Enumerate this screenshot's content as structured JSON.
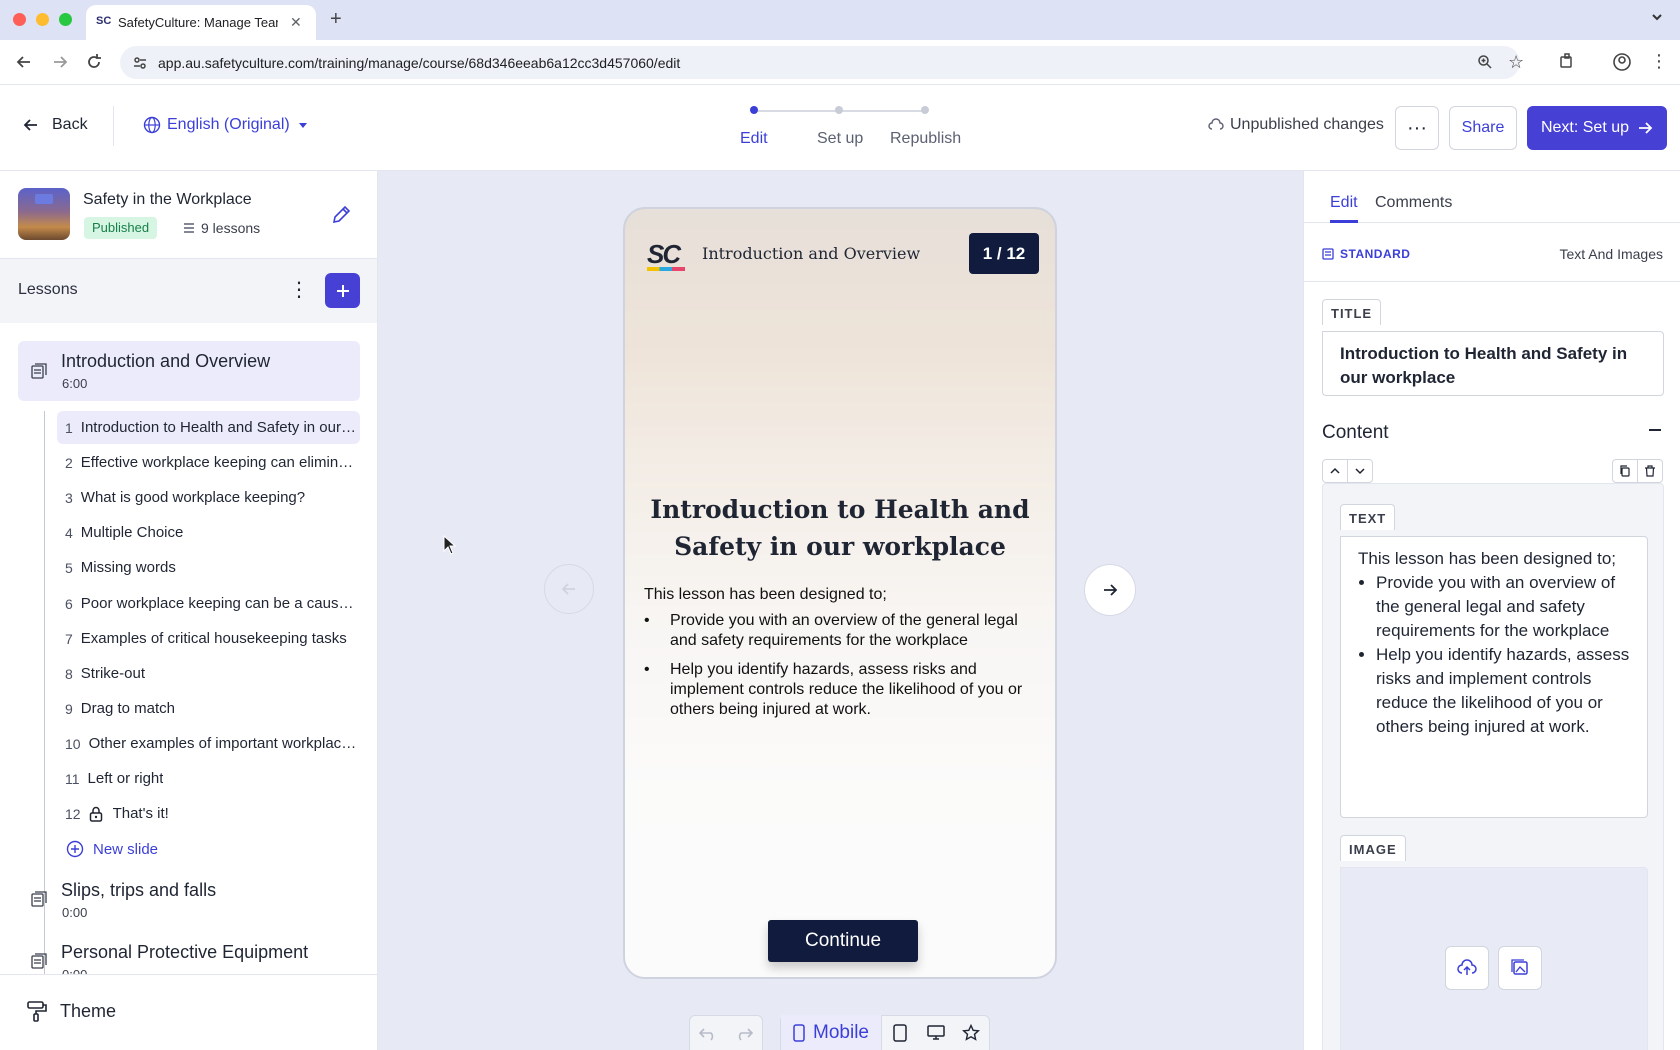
{
  "browser": {
    "tab_title": "SafetyCulture: Manage Teams",
    "url": "app.au.safetyculture.com/training/manage/course/68d346eeab6a12cc3d457060/edit"
  },
  "header": {
    "back_label": "Back",
    "language_label": "English (Original)",
    "steps": [
      "Edit",
      "Set up",
      "Republish"
    ],
    "active_step": 0,
    "unpublished_label": "Unpublished changes",
    "share_label": "Share",
    "next_label": "Next: Set up"
  },
  "course": {
    "title": "Safety in the Workplace",
    "status": "Published",
    "lessons_count": "9 lessons"
  },
  "sidebar": {
    "lessons_label": "Lessons",
    "lessons": [
      {
        "title": "Introduction and Overview",
        "duration": "6:00"
      },
      {
        "title": "Slips, trips and falls",
        "duration": "0:00"
      },
      {
        "title": "Personal Protective Equipment",
        "duration": "0:00"
      }
    ],
    "slides": [
      {
        "num": "1",
        "title": "Introduction to Health and Safety in our workplace"
      },
      {
        "num": "2",
        "title": "Effective workplace keeping can eliminate hazards"
      },
      {
        "num": "3",
        "title": "What is good workplace keeping?"
      },
      {
        "num": "4",
        "title": "Multiple Choice"
      },
      {
        "num": "5",
        "title": "Missing words"
      },
      {
        "num": "6",
        "title": "Poor workplace keeping can be a cause of accidents"
      },
      {
        "num": "7",
        "title": "Examples of critical housekeeping tasks"
      },
      {
        "num": "8",
        "title": "Strike-out"
      },
      {
        "num": "9",
        "title": "Drag to match"
      },
      {
        "num": "10",
        "title": "Other examples of important workplace keeping"
      },
      {
        "num": "11",
        "title": "Left or right"
      },
      {
        "num": "12",
        "title": "That's it!"
      }
    ],
    "new_slide_label": "New slide",
    "theme_label": "Theme"
  },
  "preview": {
    "logo": "SC",
    "header_title": "Introduction and Overview",
    "counter": "1 / 12",
    "slide_title": "Introduction to Health and Safety in our workplace",
    "intro": "This lesson has been designed to;",
    "bullets": [
      "Provide you with an overview of the general legal and safety requirements for the workplace",
      "Help you identify hazards, assess risks and implement controls reduce the likelihood of you or others being injured at work."
    ],
    "continue_label": "Continue",
    "device_label": "Mobile"
  },
  "panel": {
    "tabs": [
      "Edit",
      "Comments"
    ],
    "type_label": "STANDARD",
    "type_value": "Text And Images",
    "title_tag": "TITLE",
    "title_value": "Introduction to Health and Safety in our workplace",
    "content_label": "Content",
    "text_tag": "TEXT",
    "text_intro": "This lesson has been designed to;",
    "text_bullets": [
      "Provide you with an overview of the general legal and safety requirements for the workplace",
      "Help you identify hazards, assess risks and implement controls reduce the likelihood of you or others being injured at work."
    ],
    "image_tag": "IMAGE"
  },
  "colors": {
    "accent": "#4740d4",
    "published_bg": "#d7f5e3",
    "published_fg": "#17804a",
    "navy": "#101b3d"
  }
}
